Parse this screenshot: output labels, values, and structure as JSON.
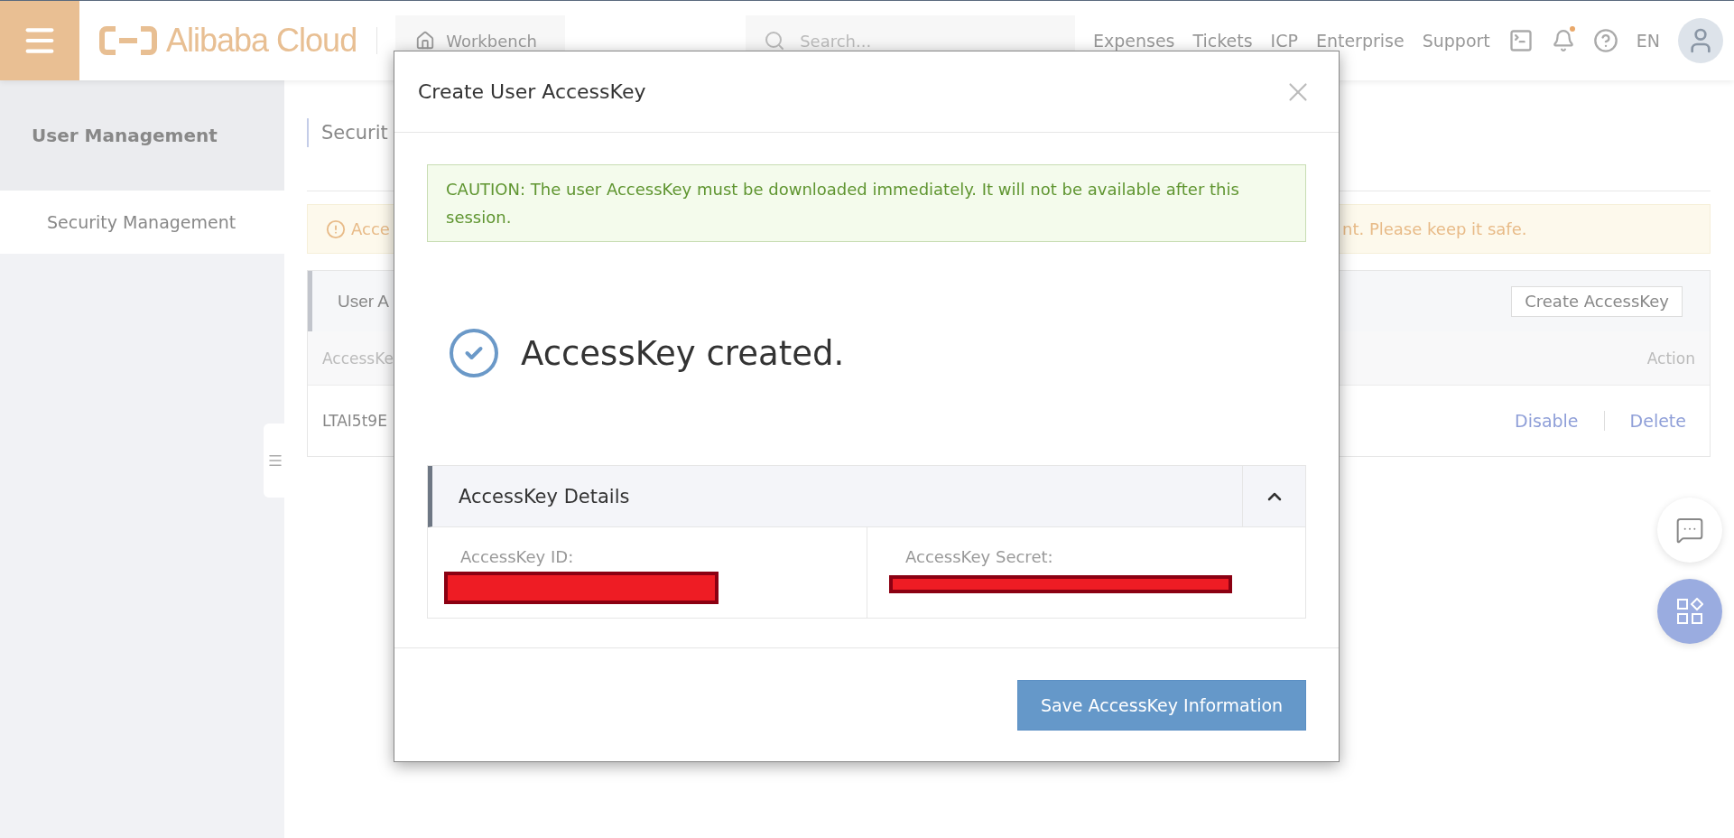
{
  "topbar": {
    "brand": "Alibaba Cloud",
    "workbench": "Workbench",
    "search": {
      "placeholder": "Search..."
    },
    "nav": [
      "Expenses",
      "Tickets",
      "ICP",
      "Enterprise",
      "Support"
    ],
    "language": "EN"
  },
  "sidebar": {
    "title": "User Management",
    "items": [
      {
        "label": "Security Management",
        "selected": true
      }
    ]
  },
  "page": {
    "title": "Securit",
    "notice": {
      "left": "Acce",
      "right": "nt. Please keep it safe."
    },
    "card": {
      "title": "User A",
      "create_button": "Create AccessKey",
      "columns": [
        "AccessKe",
        "Action"
      ],
      "rows": [
        {
          "cells": [
            "LTAI5t9E"
          ],
          "actions": [
            "Disable",
            "Delete"
          ]
        }
      ]
    }
  },
  "dialog": {
    "title": "Create User AccessKey",
    "caution": "CAUTION: The user AccessKey must be downloaded immediately. It will not be available after this session.",
    "status": "AccessKey created.",
    "details": {
      "title": "AccessKey Details",
      "expanded": true,
      "fields": [
        {
          "label": "AccessKey ID:",
          "redacted": true
        },
        {
          "label": "AccessKey Secret:",
          "redacted": true
        }
      ]
    },
    "save_button": "Save AccessKey Information"
  }
}
